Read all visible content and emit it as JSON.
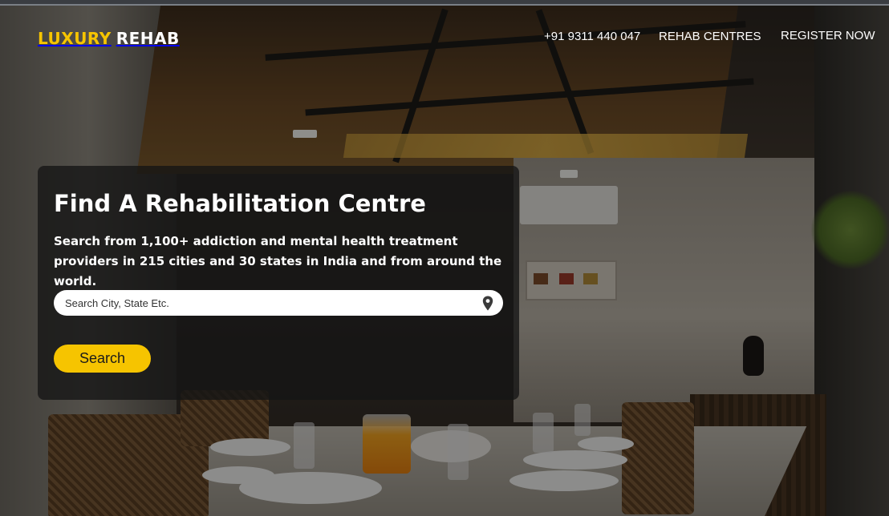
{
  "header": {
    "logo": {
      "part1": "LUXURY",
      "part2": "REHAB"
    },
    "nav": {
      "phone": "+91 9311 440 047",
      "centres": "REHAB CENTRES",
      "register": "REGISTER NOW"
    }
  },
  "hero": {
    "title": "Find A Rehabilitation Centre",
    "description": "Search from 1,100+ addiction and mental health treatment providers in 215 cities and 30 states in India and from around the world.",
    "search": {
      "placeholder": "Search City, State Etc.",
      "value": "",
      "icon": "map-pin-icon"
    },
    "button_label": "Search"
  },
  "colors": {
    "brand_yellow": "#f6c400",
    "panel_bg": "rgba(20,20,20,0.78)"
  }
}
